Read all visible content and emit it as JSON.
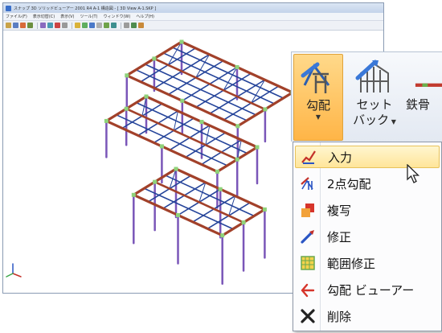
{
  "window": {
    "title": "スナップ 3D ソリッドビューアー 2001 R4  A-1 構造図 - [ 3D View A-1.SKP ]",
    "menu": [
      "ファイル(F)",
      "表示切替(C)",
      "表示(V)",
      "ツール(T)",
      "ウィンドウ(W)",
      "ヘルプ(H)"
    ]
  },
  "ribbon": {
    "buttons": [
      {
        "label": "勾配",
        "label2": "",
        "icon": "roof-slope-icon",
        "active": true
      },
      {
        "label": "セット",
        "label2": "バック",
        "icon": "setback-icon",
        "active": false
      },
      {
        "label": "鉄骨",
        "label2": "",
        "icon": "steel-icon",
        "active": false
      }
    ]
  },
  "dropdown": {
    "items": [
      {
        "label": "入力",
        "icon": "pencil-input-icon",
        "highlighted": true
      },
      {
        "label": "2点勾配",
        "icon": "two-point-slope-icon",
        "highlighted": false
      },
      {
        "label": "複写",
        "icon": "copy-icon",
        "highlighted": false
      },
      {
        "label": "修正",
        "icon": "edit-icon",
        "highlighted": false
      },
      {
        "label": "範囲修正",
        "icon": "range-edit-icon",
        "highlighted": false
      },
      {
        "label": "勾配 ビューアー",
        "icon": "slope-viewer-icon",
        "highlighted": false
      },
      {
        "label": "削除",
        "icon": "delete-icon",
        "highlighted": false
      }
    ]
  },
  "colors": {
    "accent_active": "#ffb547",
    "highlight": "#ffe59a",
    "beam_red": "#a2412a",
    "beam_blue": "#25449a",
    "column_purple": "#7a56b8"
  }
}
